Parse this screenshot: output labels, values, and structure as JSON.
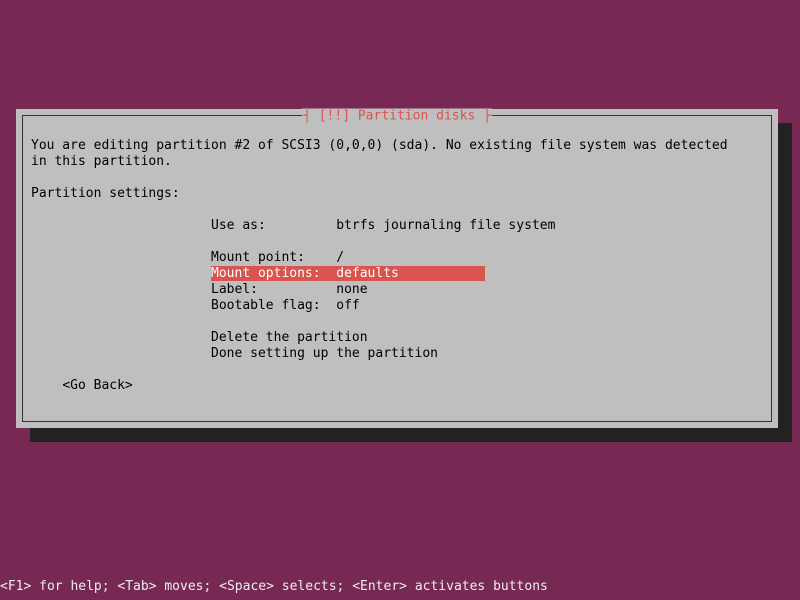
{
  "dialog": {
    "title_left": "┤ ",
    "title_text": "[!!] Partition disks",
    "title_right": " ├",
    "intro_line1": "You are editing partition #2 of SCSI3 (0,0,0) (sda). No existing file system was detected",
    "intro_line2": "in this partition.",
    "settings_header": "Partition settings:",
    "settings": {
      "use_as": {
        "label": "Use as:        ",
        "value": "btrfs journaling file system"
      },
      "mount_point": {
        "label": "Mount point:   ",
        "value": "/"
      },
      "mount_options": {
        "label": "Mount options: ",
        "value": "defaults"
      },
      "label": {
        "label": "Label:         ",
        "value": "none"
      },
      "bootable": {
        "label": "Bootable flag: ",
        "value": "off"
      }
    },
    "actions": {
      "delete": "Delete the partition",
      "done": "Done setting up the partition"
    },
    "go_back": "<Go Back>"
  },
  "footer": "<F1> for help; <Tab> moves; <Space> selects; <Enter> activates buttons",
  "colors": {
    "background": "#772953",
    "dialog_bg": "#bfbfbf",
    "accent": "#d9534f"
  }
}
